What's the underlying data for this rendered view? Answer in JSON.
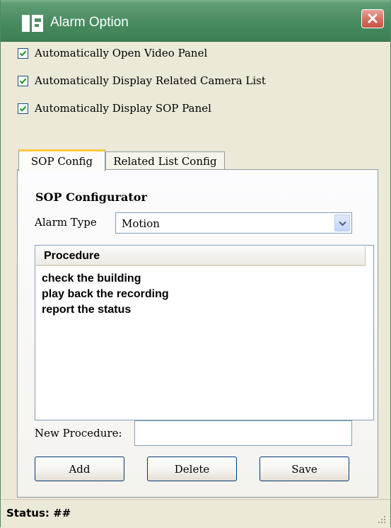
{
  "window": {
    "title": "Alarm Option",
    "close_icon": "close-icon"
  },
  "options": [
    {
      "label": "Automatically Open Video Panel",
      "checked": true
    },
    {
      "label": "Automatically Display Related Camera List",
      "checked": true
    },
    {
      "label": "Automatically Display SOP Panel",
      "checked": true
    }
  ],
  "tabs": [
    {
      "label": "SOP Config",
      "active": true
    },
    {
      "label": "Related List Config",
      "active": false
    }
  ],
  "sop": {
    "title": "SOP Configurator",
    "alarm_type_label": "Alarm Type",
    "alarm_type_value": "Motion",
    "list_header": "Procedure",
    "procedures": [
      "check the building",
      "play back the recording",
      "report the status"
    ],
    "new_procedure_label": "New Procedure:",
    "new_procedure_value": "",
    "buttons": {
      "add": "Add",
      "delete": "Delete",
      "save": "Save"
    }
  },
  "status": {
    "text": "Status: ##"
  },
  "colors": {
    "title_bar": "#468a5f",
    "close_button": "#d86c5d",
    "active_tab_accent": "#ffc83c",
    "check_mark": "#21a121"
  }
}
